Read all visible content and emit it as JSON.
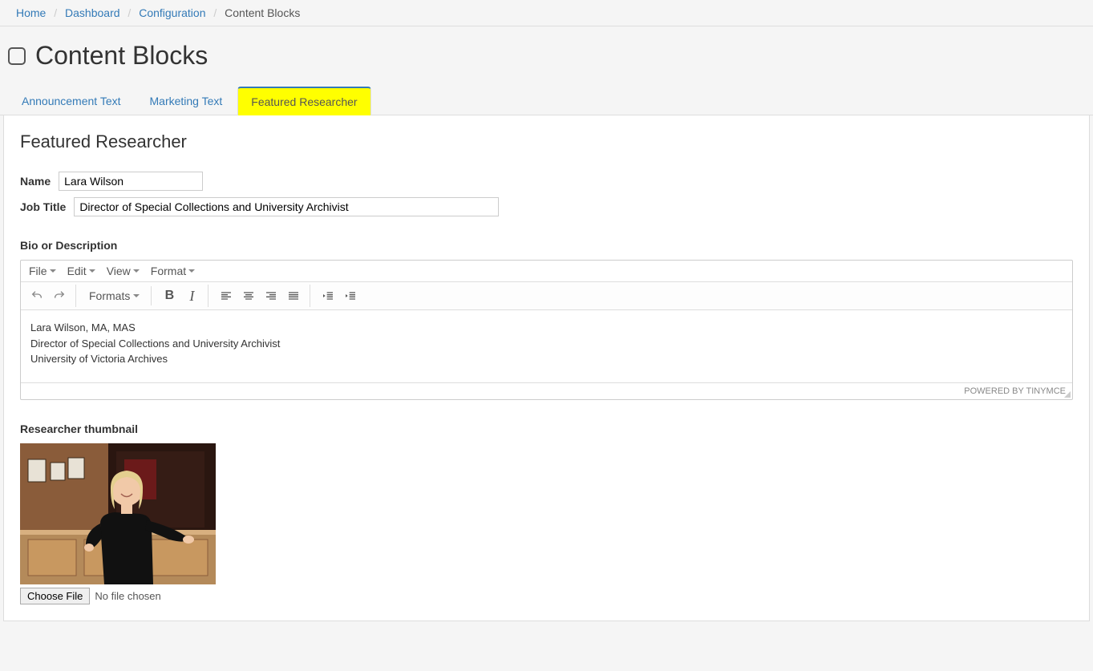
{
  "breadcrumb": {
    "items": [
      "Home",
      "Dashboard",
      "Configuration"
    ],
    "current": "Content Blocks"
  },
  "page_title": "Content Blocks",
  "tabs": {
    "announcement": "Announcement Text",
    "marketing": "Marketing Text",
    "featured": "Featured Researcher"
  },
  "section_heading": "Featured Researcher",
  "form": {
    "name_label": "Name",
    "name_value": "Lara Wilson",
    "jobtitle_label": "Job Title",
    "jobtitle_value": "Director of Special Collections and University Archivist",
    "bio_label": "Bio or Description",
    "thumbnail_label": "Researcher thumbnail"
  },
  "editor": {
    "menu": {
      "file": "File",
      "edit": "Edit",
      "view": "View",
      "format": "Format"
    },
    "formats_label": "Formats",
    "content_lines": [
      "Lara Wilson, MA, MAS",
      "Director of Special Collections and University Archivist",
      "University of Victoria Archives"
    ],
    "footer": "POWERED BY TINYMCE"
  },
  "file_picker": {
    "button": "Choose File",
    "status": "No file chosen"
  }
}
